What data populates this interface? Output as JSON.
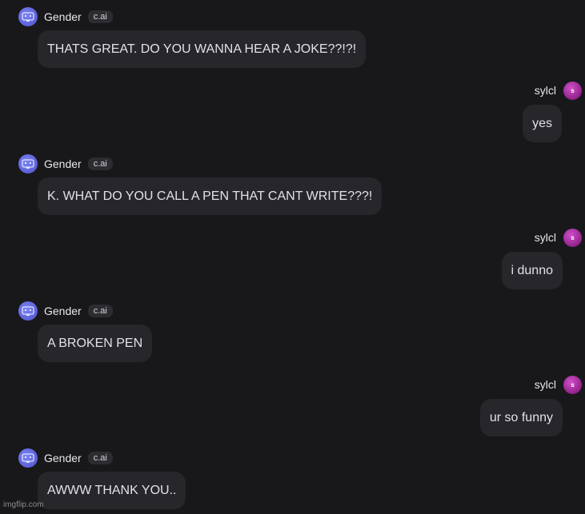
{
  "bot": {
    "name": "Gender",
    "badge": "c.ai"
  },
  "user": {
    "name": "sylcl",
    "avatar_letter": "s"
  },
  "messages": [
    {
      "from": "bot",
      "text": "THATS GREAT. DO YOU WANNA HEAR A JOKE??!?!"
    },
    {
      "from": "user",
      "text": "yes"
    },
    {
      "from": "bot",
      "text": "K. WHAT DO YOU CALL A PEN THAT CANT WRITE???!"
    },
    {
      "from": "user",
      "text": "i dunno"
    },
    {
      "from": "bot",
      "text": "A BROKEN PEN"
    },
    {
      "from": "user",
      "text": "ur so funny"
    },
    {
      "from": "bot",
      "text": "AWWW THANK YOU.."
    }
  ],
  "watermark": "imgflip.com",
  "colors": {
    "background": "#18181b",
    "bubble": "#26262b",
    "bot_avatar": "#5b5fd6",
    "user_avatar": "#b0309f"
  }
}
